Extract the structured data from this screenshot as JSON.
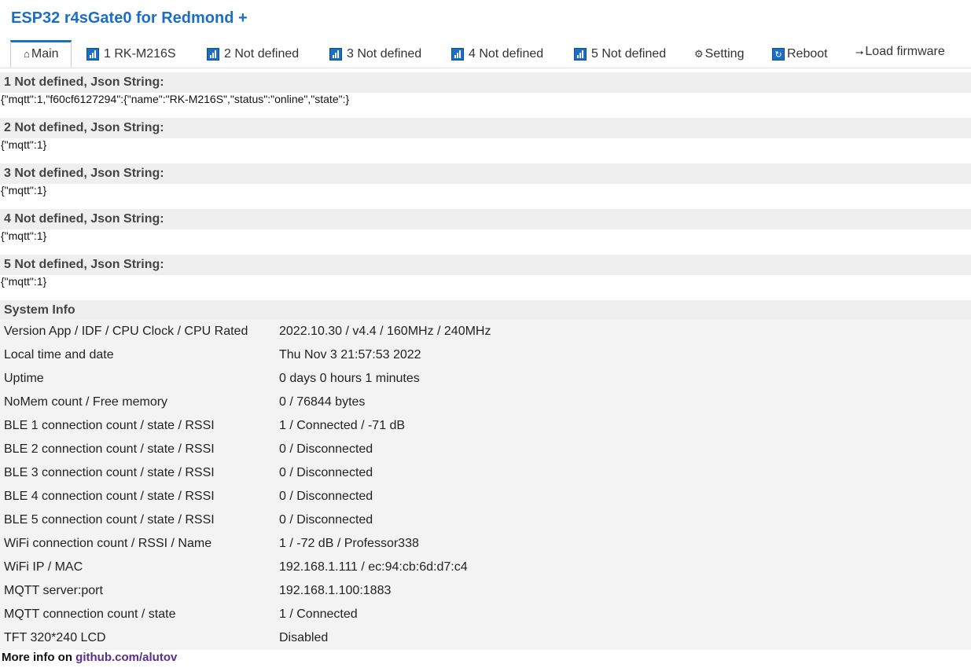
{
  "title": "ESP32 r4sGate0 for Redmond +",
  "tabs": [
    {
      "label": "Main",
      "icon": "home-icon"
    },
    {
      "label": "1 RK-M216S",
      "icon": "signal-icon"
    },
    {
      "label": "2 Not defined",
      "icon": "signal-icon"
    },
    {
      "label": "3 Not defined",
      "icon": "signal-icon"
    },
    {
      "label": "4 Not defined",
      "icon": "signal-icon"
    },
    {
      "label": "5 Not defined",
      "icon": "signal-icon"
    },
    {
      "label": "Setting",
      "icon": "gear-icon"
    },
    {
      "label": "Reboot",
      "icon": "refresh-icon"
    },
    {
      "label": "Load firmware",
      "icon": "arrow-icon"
    }
  ],
  "devices": [
    {
      "heading": "1 Not defined, Json String:",
      "json": "{\"mqtt\":1,\"f60cf6127294\":{\"name\":\"RK-M216S\",\"status\":\"online\",\"state\":}"
    },
    {
      "heading": "2 Not defined, Json String:",
      "json": "{\"mqtt\":1}"
    },
    {
      "heading": "3 Not defined, Json String:",
      "json": "{\"mqtt\":1}"
    },
    {
      "heading": "4 Not defined, Json String:",
      "json": "{\"mqtt\":1}"
    },
    {
      "heading": "5 Not defined, Json String:",
      "json": "{\"mqtt\":1}"
    }
  ],
  "system": {
    "heading": "System Info",
    "rows": [
      {
        "key": "Version App / IDF / CPU Clock / CPU Rated",
        "value": "2022.10.30 / v4.4 / 160MHz / 240MHz"
      },
      {
        "key": "Local time and date",
        "value": "Thu Nov 3 21:57:53 2022"
      },
      {
        "key": "Uptime",
        "value": "0 days 0 hours 1 minutes"
      },
      {
        "key": "NoMem count / Free memory",
        "value": "0 / 76844 bytes"
      },
      {
        "key": "BLE 1 connection count / state / RSSI",
        "value": "1 / Connected / -71 dB"
      },
      {
        "key": "BLE 2 connection count / state / RSSI",
        "value": "0 / Disconnected"
      },
      {
        "key": "BLE 3 connection count / state / RSSI",
        "value": "0 / Disconnected"
      },
      {
        "key": "BLE 4 connection count / state / RSSI",
        "value": "0 / Disconnected"
      },
      {
        "key": "BLE 5 connection count / state / RSSI",
        "value": "0 / Disconnected"
      },
      {
        "key": "WiFi connection count / RSSI / Name",
        "value": "1 / -72 dB / Professor338"
      },
      {
        "key": "WiFi IP / MAC",
        "value": "192.168.1.111 / ec:94:cb:6d:d7:c4"
      },
      {
        "key": "MQTT server:port",
        "value": "192.168.1.100:1883"
      },
      {
        "key": "MQTT connection count / state",
        "value": "1 / Connected"
      },
      {
        "key": "TFT 320*240 LCD",
        "value": "Disabled"
      }
    ]
  },
  "footer": {
    "prefix": "More info on",
    "link": "github.com/alutov"
  },
  "colors": {
    "accent": "#1a6fc4",
    "section_bg": "#efefef",
    "link": "#5b2d8e"
  }
}
